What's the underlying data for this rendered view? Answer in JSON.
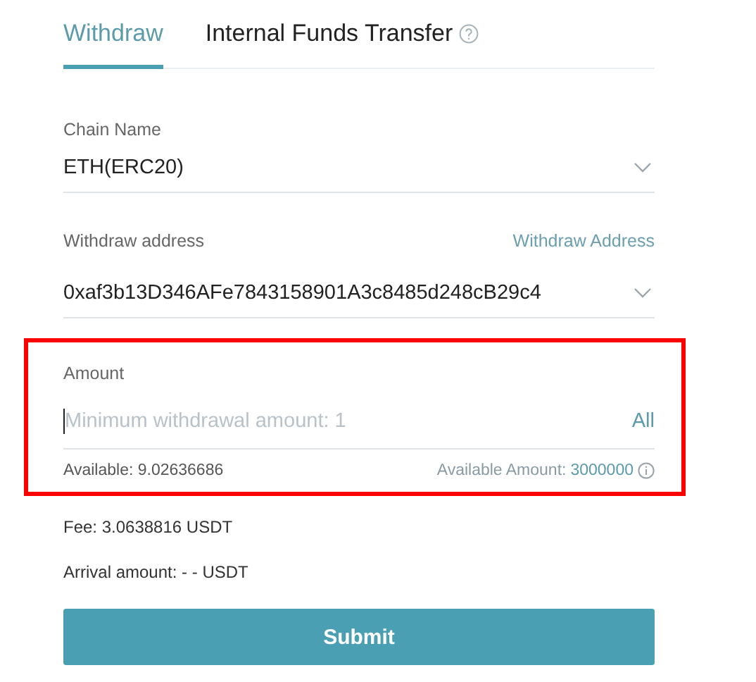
{
  "tabs": [
    {
      "label": "Withdraw",
      "selected": true,
      "help": false
    },
    {
      "label": "Internal Funds Transfer",
      "selected": false,
      "help": true
    }
  ],
  "chain": {
    "label": "Chain Name",
    "value": "ETH(ERC20)"
  },
  "address": {
    "label": "Withdraw address",
    "link": "Withdraw Address",
    "value": "0xaf3b13D346AFe7843158901A3c8485d248cB29c4"
  },
  "amount": {
    "label": "Amount",
    "placeholder": "Minimum withdrawal amount: 1",
    "all": "All",
    "available": "Available: 9.02636686",
    "available_amount_label": "Available Amount:",
    "available_amount_value": "3000000"
  },
  "fee": "Fee: 3.0638816 USDT",
  "arrival": "Arrival amount: - - USDT",
  "submit": "Submit"
}
